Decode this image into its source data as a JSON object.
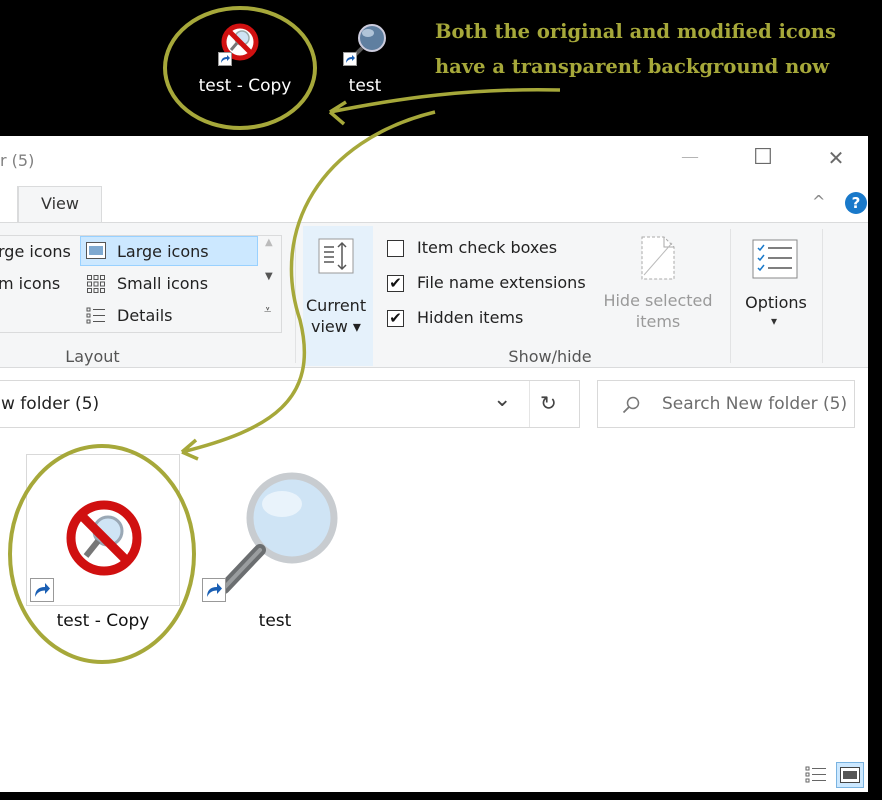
{
  "desktop": {
    "icons": [
      {
        "label": "test - Copy"
      },
      {
        "label": "test"
      }
    ],
    "annotation": {
      "line1": "Both the original and modified icons",
      "line2": "have a transparent background now",
      "color": "#a6a83a"
    }
  },
  "window": {
    "title": "r (5)",
    "controls": {
      "minimize": "—",
      "maximize": "☐",
      "close": "✕"
    },
    "tabs": [
      {
        "label": "View"
      }
    ],
    "help_label": "?",
    "collapse_label": "^",
    "ribbon": {
      "layout": {
        "options": [
          {
            "label": "rge icons"
          },
          {
            "label": "Large icons"
          },
          {
            "label": "m icons"
          },
          {
            "label": "Small icons"
          },
          {
            "label": "Details"
          }
        ],
        "group_label": "Layout"
      },
      "current_view": {
        "line1": "Current",
        "line2": "view ▾"
      },
      "show_hide": {
        "item_check_boxes": {
          "label": "Item check boxes",
          "checked": false
        },
        "file_name_extensions": {
          "label": "File name extensions",
          "checked": true
        },
        "hidden_items": {
          "label": "Hidden items",
          "checked": true
        },
        "hide_selected": {
          "line1": "Hide selected",
          "line2": "items"
        },
        "group_label": "Show/hide"
      },
      "options": {
        "label": "Options",
        "arrow": "▾"
      }
    },
    "address": {
      "path": "w folder (5)",
      "refresh": "↻",
      "dropdown": "⌄"
    },
    "search": {
      "placeholder": "Search New folder (5)"
    },
    "files": [
      {
        "label": "test - Copy",
        "selected": true
      },
      {
        "label": "test",
        "selected": false
      }
    ]
  },
  "colors": {
    "annotation": "#a6a83a",
    "selected_layout": "#cce8ff",
    "accent_blue": "#1979ca"
  }
}
